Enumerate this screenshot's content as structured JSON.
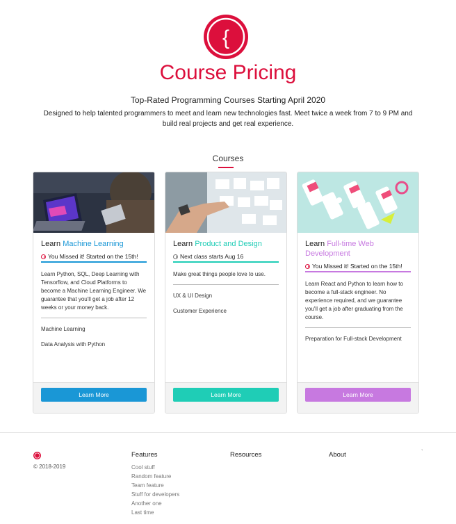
{
  "header": {
    "title": "Course Pricing",
    "subtitle": "Top-Rated Programming Courses Starting April 2020",
    "description": "Designed to help talented programmers to meet and learn new technologies fast. Meet twice a week from 7 to 9 PM and build real projects and get real experience.",
    "logo_glyph": "{",
    "logo_color": "#dc0f3c"
  },
  "courses_section": {
    "heading": "Courses"
  },
  "cards": [
    {
      "title_prefix": "Learn",
      "title_topic": "Machine Learning",
      "accent": "#1a97d6",
      "status": "You Missed it! Started on the 15th!",
      "status_color": "#dc0f3c",
      "description": "Learn Python, SQL, Deep Learning with Tensorflow, and Cloud Platforms to become a Machine Learning Engineer. We guarantee that you'll get a job after 12 weeks or your money back.",
      "topics": [
        "Machine Learning",
        "Data Analysis with Python"
      ],
      "button_label": "Learn More"
    },
    {
      "title_prefix": "Learn",
      "title_topic": "Product and Design",
      "accent": "#1fcdb6",
      "status": "Next class starts Aug 16",
      "status_color": "#777777",
      "description": "Make great things people love to use.",
      "topics": [
        "UX & UI Design",
        "Customer Experience"
      ],
      "button_label": "Learn More"
    },
    {
      "title_prefix": "Learn",
      "title_topic": "Full-time Web Development",
      "accent": "#c779e0",
      "status": "You Missed it! Started on the 15th!",
      "status_color": "#dc0f3c",
      "description": "Learn React and Python to learn how to become a full-stack engineer. No experience required, and we guarantee you'll get a job after graduating from the course.",
      "topics": [
        "Preparation for Full-stack Development"
      ],
      "button_label": "Learn More"
    }
  ],
  "footer": {
    "copyright": "© 2018-2019",
    "stray_mark": "`",
    "columns": [
      {
        "title": "Features",
        "links": [
          "Cool stuff",
          "Random feature",
          "Team feature",
          "Stuff for developers",
          "Another one",
          "Last time"
        ]
      },
      {
        "title": "Resources",
        "links": []
      },
      {
        "title": "About",
        "links": []
      }
    ]
  }
}
